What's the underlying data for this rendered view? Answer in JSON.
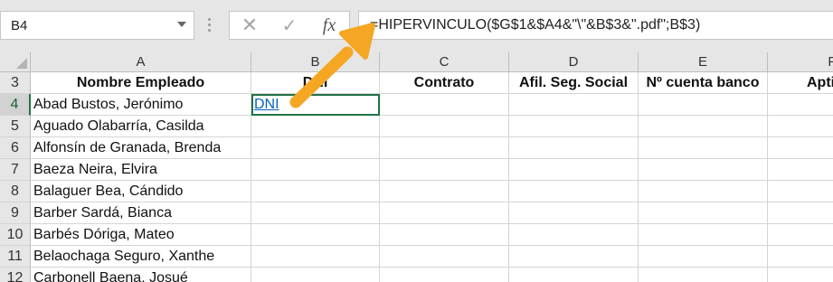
{
  "name_box": {
    "value": "B4"
  },
  "formula_bar": {
    "cancel_icon": "close-icon",
    "enter_icon": "check-icon",
    "fx_label": "fx",
    "formula": "=HIPERVINCULO($G$1&$A4&\"\\\"&B$3&\".pdf\";B$3)"
  },
  "columns": [
    "A",
    "B",
    "C",
    "D",
    "E",
    "F"
  ],
  "rows": [
    {
      "num": "3",
      "cells": [
        "Nombre Empleado",
        "DNI",
        "Contrato",
        "Afil. Seg. Social",
        "Nº cuenta banco",
        "Aptitud"
      ]
    },
    {
      "num": "4",
      "cells": [
        "Abad Bustos, Jerónimo",
        "DNI",
        "",
        "",
        "",
        ""
      ]
    },
    {
      "num": "5",
      "cells": [
        "Aguado Olabarría, Casilda",
        "",
        "",
        "",
        "",
        ""
      ]
    },
    {
      "num": "6",
      "cells": [
        "Alfonsín de Granada, Brenda",
        "",
        "",
        "",
        "",
        ""
      ]
    },
    {
      "num": "7",
      "cells": [
        "Baeza Neira, Elvira",
        "",
        "",
        "",
        "",
        ""
      ]
    },
    {
      "num": "8",
      "cells": [
        "Balaguer Bea, Cándido",
        "",
        "",
        "",
        "",
        ""
      ]
    },
    {
      "num": "9",
      "cells": [
        "Barber Sardá, Bianca",
        "",
        "",
        "",
        "",
        ""
      ]
    },
    {
      "num": "10",
      "cells": [
        "Barbés Dóriga, Mateo",
        "",
        "",
        "",
        "",
        ""
      ]
    },
    {
      "num": "11",
      "cells": [
        "Belaochaga Seguro, Xanthe",
        "",
        "",
        "",
        "",
        ""
      ]
    },
    {
      "num": "12",
      "cells": [
        "Carbonell Baena, Josué",
        "",
        "",
        "",
        "",
        ""
      ]
    }
  ],
  "colors": {
    "arrow": "#f5a623",
    "link": "#0563c1",
    "selection": "#217346"
  }
}
